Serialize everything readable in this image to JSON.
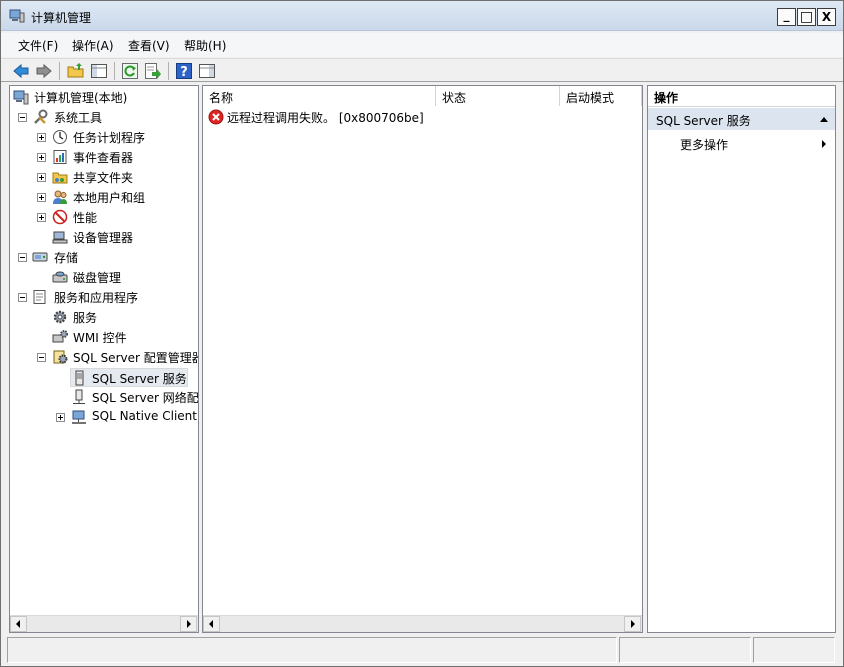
{
  "window": {
    "title": "计算机管理",
    "controls": {
      "minimize": "_",
      "maximize": "□",
      "close": "X"
    }
  },
  "menu": [
    {
      "label": "文件(F)"
    },
    {
      "label": "操作(A)"
    },
    {
      "label": "查看(V)"
    },
    {
      "label": "帮助(H)"
    }
  ],
  "toolbar": {
    "icons": [
      "back-arrow-icon",
      "forward-arrow-icon",
      "up-folder-icon",
      "show-hide-tree-icon",
      "refresh-icon",
      "export-list-icon",
      "help-icon",
      "show-hide-action-pane-icon"
    ]
  },
  "tree": {
    "root": "计算机管理(本地)",
    "system_tools": "系统工具",
    "task_scheduler": "任务计划程序",
    "event_viewer": "事件查看器",
    "shared_folders": "共享文件夹",
    "local_users": "本地用户和组",
    "performance": "性能",
    "device_manager": "设备管理器",
    "storage": "存储",
    "disk_management": "磁盘管理",
    "services_apps": "服务和应用程序",
    "services": "服务",
    "wmi": "WMI 控件",
    "sql_config": "SQL Server 配置管理器",
    "sql_services": "SQL Server 服务",
    "sql_network": "SQL Server 网络配置",
    "sql_native": "SQL Native Client"
  },
  "list": {
    "columns": [
      "名称",
      "状态",
      "启动模式"
    ],
    "error_message": "远程过程调用失败。 [0x800706be]"
  },
  "actions": {
    "header": "操作",
    "section": "SQL Server 服务",
    "more": "更多操作"
  },
  "colors": {
    "selected_item_bg": "#e5eaf1",
    "action_section_bg": "#dbe4ef",
    "error_red": "#e02424"
  }
}
